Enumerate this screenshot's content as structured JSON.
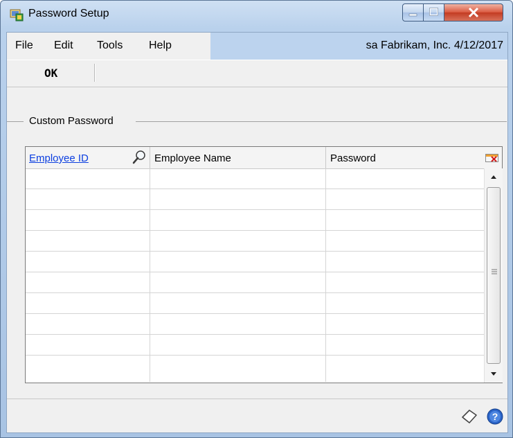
{
  "window": {
    "title": "Password Setup",
    "icon": "password-setup-app-icon"
  },
  "title_controls": {
    "minimize": "minimize-icon",
    "maximize": "maximize-icon",
    "close": "close-icon"
  },
  "menu": {
    "items": [
      "File",
      "Edit",
      "Tools",
      "Help"
    ],
    "user_info": "sa  Fabrikam, Inc. 4/12/2017"
  },
  "toolbar": {
    "ok_label": "OK"
  },
  "section": {
    "title": "Custom Password"
  },
  "grid": {
    "columns": [
      "Employee ID",
      "Employee Name",
      "Password"
    ],
    "lookup_icon": "magnifier-lookup-icon",
    "expand_icon": "show-details-icon",
    "rows": [
      [
        "",
        "",
        ""
      ],
      [
        "",
        "",
        ""
      ],
      [
        "",
        "",
        ""
      ],
      [
        "",
        "",
        ""
      ],
      [
        "",
        "",
        ""
      ],
      [
        "",
        "",
        ""
      ],
      [
        "",
        "",
        ""
      ],
      [
        "",
        "",
        ""
      ],
      [
        "",
        "",
        ""
      ],
      [
        "",
        "",
        ""
      ]
    ]
  },
  "footer": {
    "note_icon": "note-icon",
    "help_icon": "help-icon"
  },
  "colors": {
    "title_bar": "#b9d1ec",
    "menu_highlight": "#bcd3ee",
    "link": "#0b3ee0",
    "close_button": "#c33b22"
  }
}
